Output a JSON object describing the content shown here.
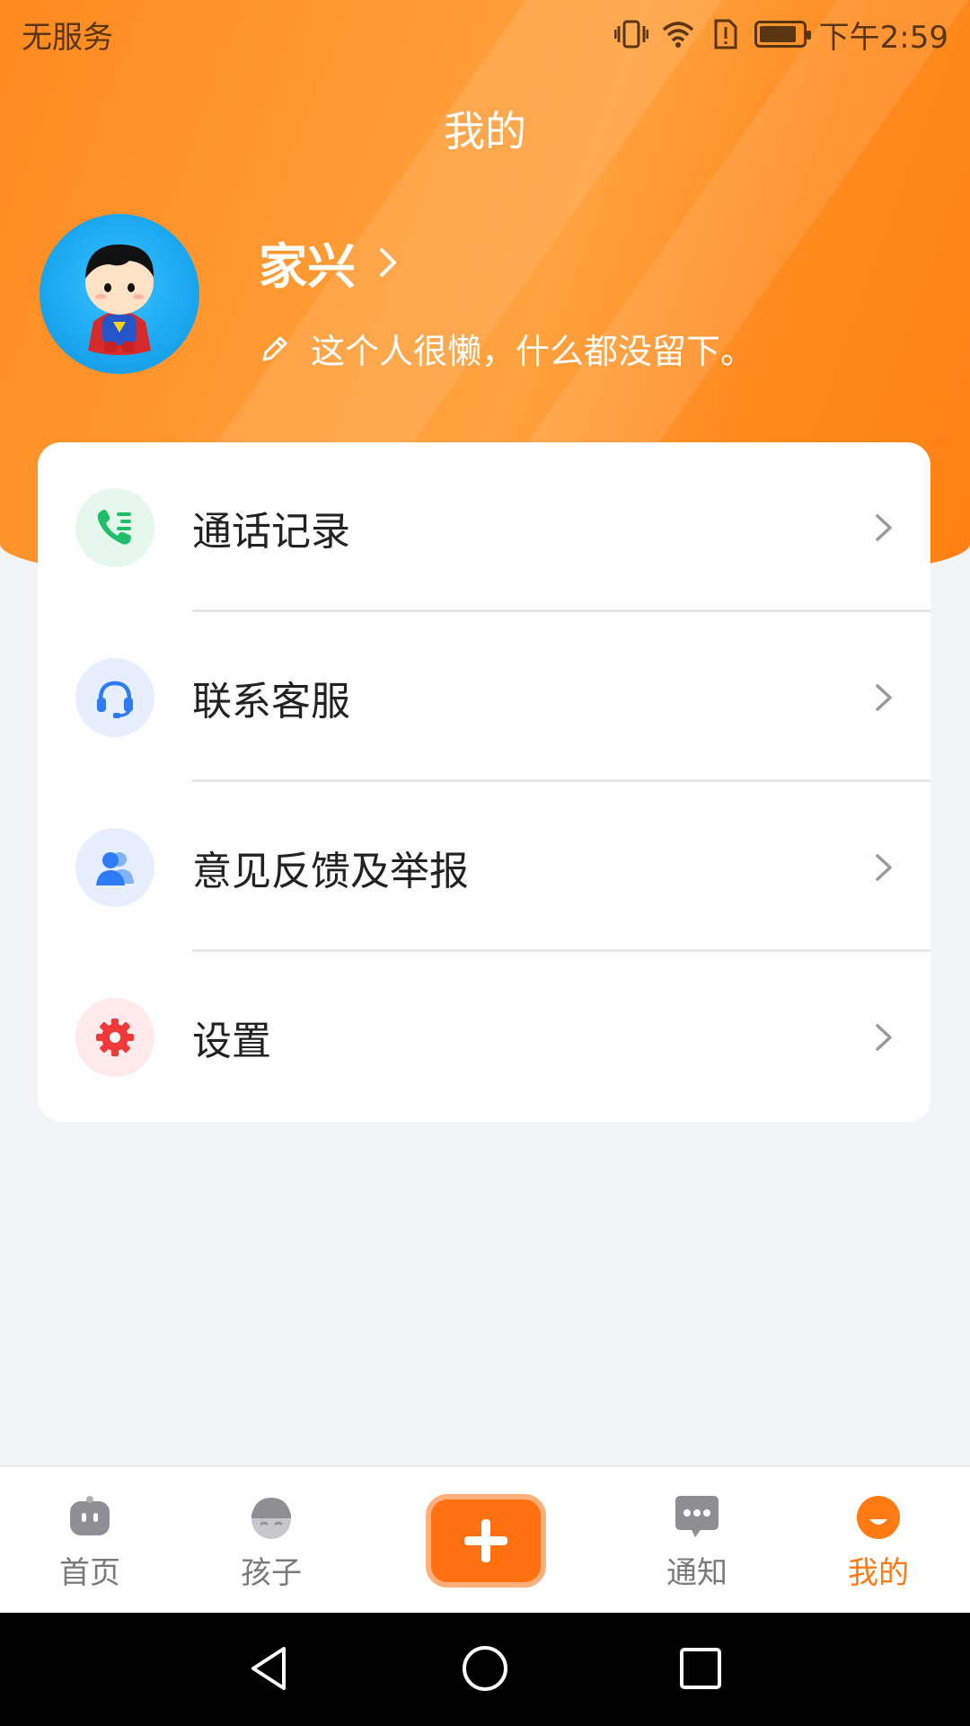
{
  "status_bar": {
    "carrier": "无服务",
    "time": "下午2:59",
    "battery_level": 0.9,
    "icons": [
      "vibrate-icon",
      "wifi-icon",
      "sim-alert-icon",
      "battery-icon"
    ]
  },
  "header": {
    "title": "我的",
    "user_name": "家兴",
    "bio": "这个人很懒，什么都没留下。",
    "accent_color": "#ff8a1e"
  },
  "menu": {
    "items": [
      {
        "label": "通话记录",
        "icon": "phone-list-icon",
        "icon_color": "#1fbf6a",
        "icon_bg": "#e6f7ee"
      },
      {
        "label": "联系客服",
        "icon": "headset-icon",
        "icon_color": "#2f7bf5",
        "icon_bg": "#e7efff"
      },
      {
        "label": "意见反馈及举报",
        "icon": "users-icon",
        "icon_color": "#2f7bf5",
        "icon_bg": "#e7efff"
      },
      {
        "label": "设置",
        "icon": "gear-icon",
        "icon_color": "#f03a3a",
        "icon_bg": "#feeaea"
      }
    ]
  },
  "bottom_nav": {
    "items": [
      {
        "label": "首页",
        "icon": "home-bot-icon",
        "active": false
      },
      {
        "label": "孩子",
        "icon": "child-icon",
        "active": false
      },
      {
        "label": "通知",
        "icon": "chat-icon",
        "active": false
      },
      {
        "label": "我的",
        "icon": "me-icon",
        "active": true
      }
    ],
    "add_icon": "plus-icon",
    "active_color": "#ff7a12"
  }
}
